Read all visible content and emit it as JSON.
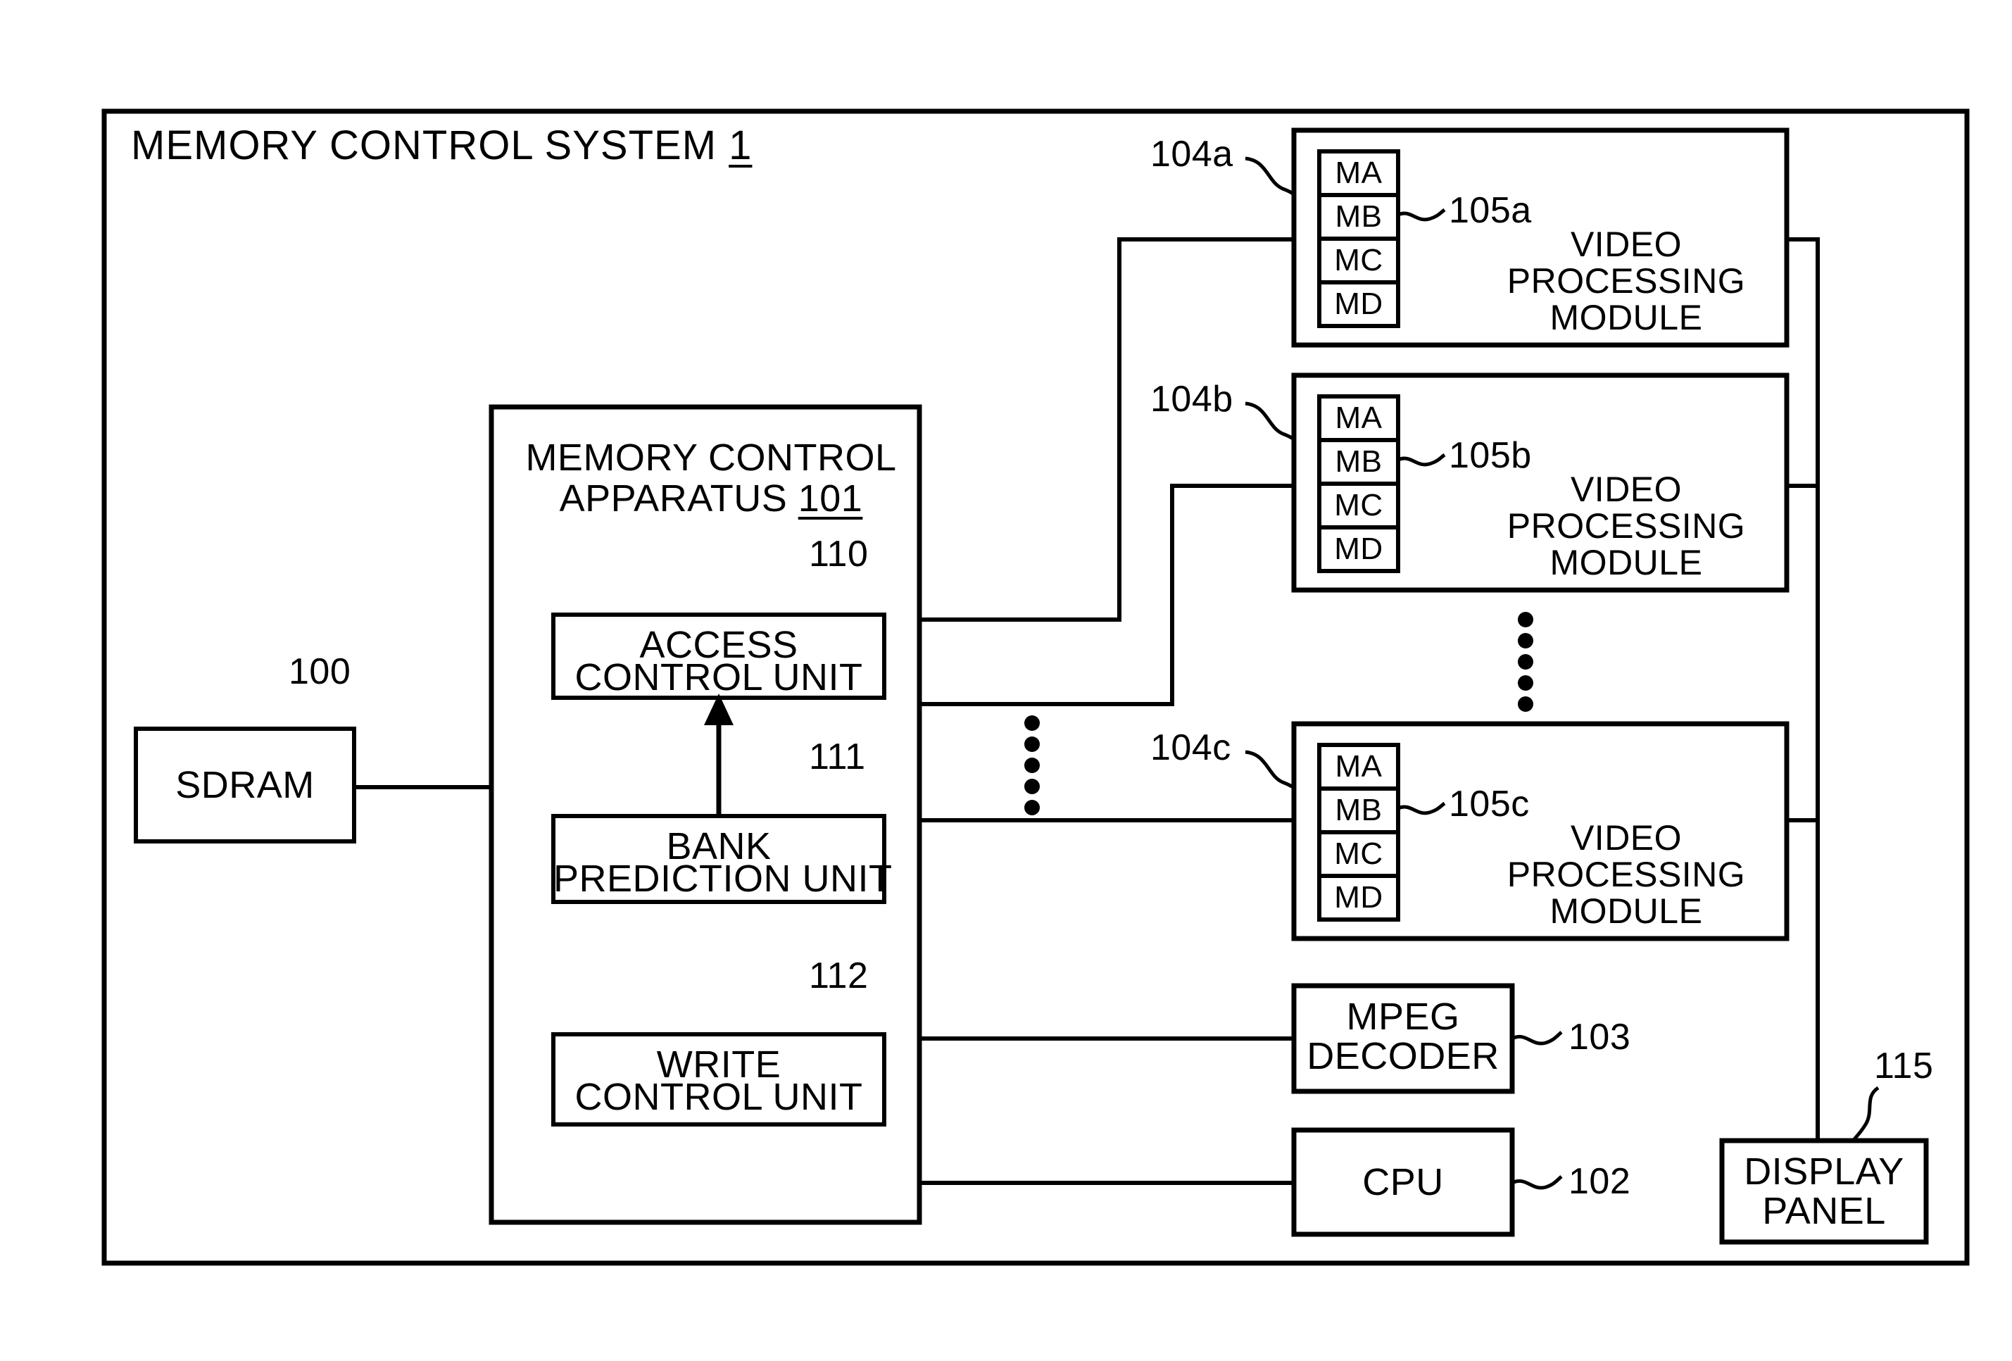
{
  "figure": {
    "system_box": {
      "title_prefix": "MEMORY CONTROL SYSTEM",
      "title_ref": "1"
    },
    "sdram": {
      "label": "SDRAM",
      "ref": "100"
    },
    "apparatus": {
      "title_line1": "MEMORY CONTROL",
      "title_line2_prefix": "APPARATUS",
      "title_ref": "101",
      "units": [
        {
          "ref": "110",
          "line1": "ACCESS",
          "line2": "CONTROL UNIT"
        },
        {
          "ref": "111",
          "line1": "BANK",
          "line2": "PREDICTION UNIT"
        },
        {
          "ref": "112",
          "line1": "WRITE",
          "line2": "CONTROL UNIT"
        }
      ]
    },
    "video_modules": [
      {
        "ref": "104a",
        "bank_ref": "105a",
        "banks": [
          "MA",
          "MB",
          "MC",
          "MD"
        ],
        "title_line1": "VIDEO",
        "title_line2": "PROCESSING",
        "title_line3": "MODULE"
      },
      {
        "ref": "104b",
        "bank_ref": "105b",
        "banks": [
          "MA",
          "MB",
          "MC",
          "MD"
        ],
        "title_line1": "VIDEO",
        "title_line2": "PROCESSING",
        "title_line3": "MODULE"
      },
      {
        "ref": "104c",
        "bank_ref": "105c",
        "banks": [
          "MA",
          "MB",
          "MC",
          "MD"
        ],
        "title_line1": "VIDEO",
        "title_line2": "PROCESSING",
        "title_line3": "MODULE"
      }
    ],
    "mpeg_decoder": {
      "line1": "MPEG",
      "line2": "DECODER",
      "ref": "103"
    },
    "cpu": {
      "label": "CPU",
      "ref": "102"
    },
    "display_panel": {
      "line1": "DISPLAY",
      "line2": "PANEL",
      "ref": "115"
    },
    "ellipses": {
      "dot_count": 5,
      "note": "vertical continuation dots"
    },
    "colors": {
      "stroke": "#000000",
      "background": "#ffffff"
    }
  }
}
